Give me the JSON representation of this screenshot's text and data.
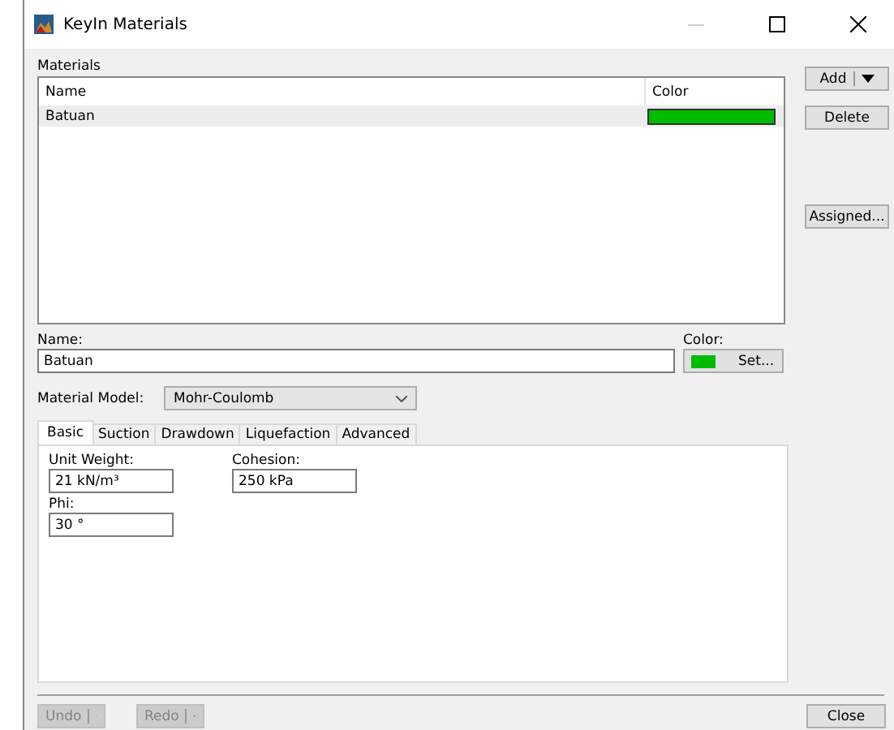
{
  "window": {
    "title": "KeyIn Materials"
  },
  "materials": {
    "label": "Materials",
    "columns": [
      "Name",
      "Color"
    ],
    "rows": [
      {
        "name": "Batuan",
        "color": "#00bb00",
        "selected": true
      }
    ]
  },
  "side_buttons": [
    {
      "label": "Add",
      "kind": "split"
    },
    {
      "label": "Delete",
      "kind": "plain"
    },
    {
      "label": "Assigned...",
      "kind": "plain"
    }
  ],
  "name": {
    "label": "Name:",
    "value": "Batuan"
  },
  "color": {
    "label": "Color:",
    "color": "#00bb00",
    "button": "Set..."
  },
  "material_model": {
    "label": "Material Model:",
    "value": "Mohr-Coulomb"
  },
  "tabs": [
    {
      "label": "Basic",
      "selected": true
    },
    {
      "label": "Suction",
      "selected": false
    },
    {
      "label": "Drawdown",
      "selected": false
    },
    {
      "label": "Liquefaction",
      "selected": false
    },
    {
      "label": "Advanced",
      "selected": false
    }
  ],
  "fields": [
    {
      "label": "Unit Weight:",
      "value": "21 kN/m³"
    },
    {
      "label": "Cohesion:",
      "value": "250 kPa"
    },
    {
      "label": "Phi:",
      "value": "30 °"
    }
  ],
  "bottom_buttons": [
    {
      "label": "Undo",
      "disabled": true
    },
    {
      "label": "Redo",
      "disabled": true
    }
  ],
  "close": "Close"
}
